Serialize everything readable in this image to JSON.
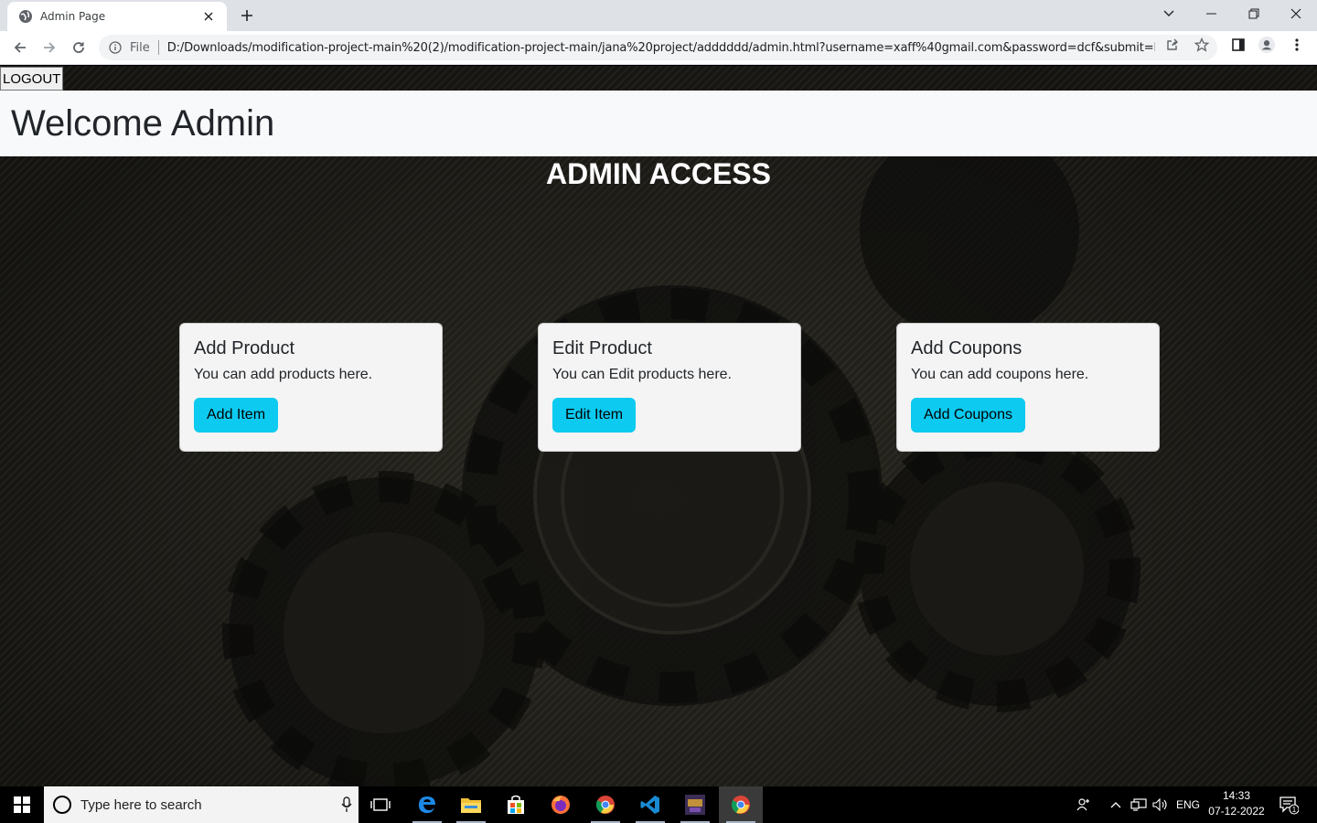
{
  "browser": {
    "tab_title": "Admin Page",
    "omnibox": {
      "scheme_label": "File",
      "url": "D:/Downloads/modification-project-main%20(2)/modification-project-main/jana%20project/adddddd/admin.html?username=xaff%40gmail.com&password=dcf&submit=Lo..."
    }
  },
  "page": {
    "logout_label": "LOGOUT",
    "navbar_brand": "Welcome Admin",
    "section_title": "ADMIN ACCESS",
    "cards": [
      {
        "title": "Add Product",
        "text": "You can add products here.",
        "button": "Add Item"
      },
      {
        "title": "Edit Product",
        "text": "You can Edit products here.",
        "button": "Edit Item"
      },
      {
        "title": "Add Coupons",
        "text": "You can add coupons here.",
        "button": "Add Coupons"
      }
    ],
    "colors": {
      "navbar_bg": "#f8f9fa",
      "card_bg": "#f4f4f4",
      "button_bg": "#0dcaf0"
    }
  },
  "taskbar": {
    "search_placeholder": "Type here to search",
    "apps": [
      "task-view-icon",
      "edge-icon",
      "file-explorer-icon",
      "store-icon",
      "firefox-icon",
      "chrome-icon",
      "vscode-icon",
      "game-icon",
      "chrome-icon"
    ],
    "tray": {
      "language": "ENG",
      "time": "14:33",
      "date": "07-12-2022",
      "notification_count": "1"
    }
  }
}
